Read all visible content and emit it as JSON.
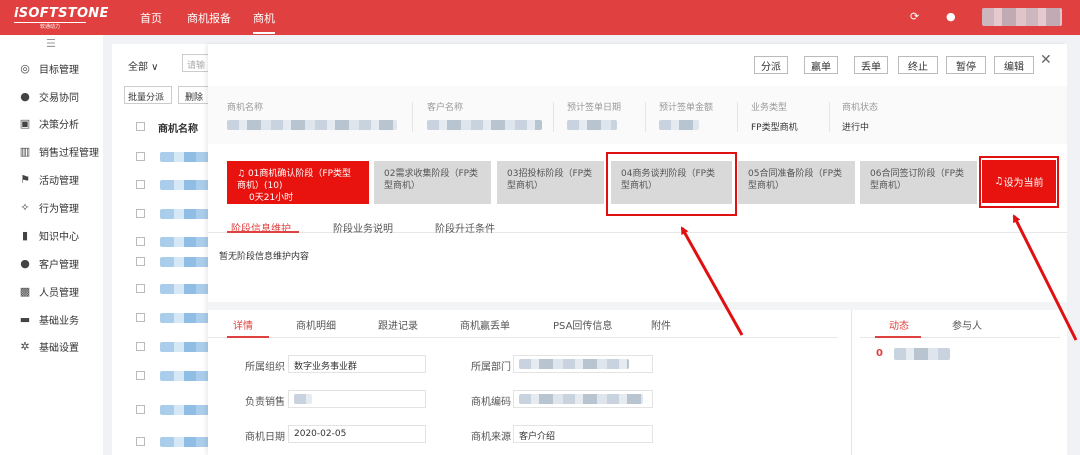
{
  "topbar": {
    "logo_main": "iSOFTSTONE",
    "logo_sub": "软通动力",
    "nav": [
      "首页",
      "商机报备",
      "商机"
    ],
    "refresh_icon": "refresh-icon",
    "user_icon": "user-icon"
  },
  "sidebar": {
    "items": [
      {
        "label": "目标管理",
        "icon": "target-icon"
      },
      {
        "label": "交易协同",
        "icon": "handshake-icon"
      },
      {
        "label": "决策分析",
        "icon": "chart-icon"
      },
      {
        "label": "销售过程管理",
        "icon": "bar-chart-icon"
      },
      {
        "label": "活动管理",
        "icon": "flag-icon"
      },
      {
        "label": "行为管理",
        "icon": "run-icon"
      },
      {
        "label": "知识中心",
        "icon": "book-icon"
      },
      {
        "label": "客户管理",
        "icon": "customer-icon"
      },
      {
        "label": "人员管理",
        "icon": "person-card-icon"
      },
      {
        "label": "基础业务",
        "icon": "briefcase-icon"
      },
      {
        "label": "基础设置",
        "icon": "gear-icon"
      }
    ]
  },
  "list": {
    "filter": "全部",
    "search_placeholder": "请输",
    "batch_assign": "批量分派",
    "delete": "删除",
    "col_name": "商机名称"
  },
  "panel": {
    "actions": [
      "分派",
      "赢单",
      "丢单",
      "终止",
      "暂停",
      "编辑"
    ],
    "info": [
      {
        "label": "商机名称",
        "value": ""
      },
      {
        "label": "客户名称",
        "value": ""
      },
      {
        "label": "预计签单日期",
        "value": ""
      },
      {
        "label": "预计签单金额",
        "value": ""
      },
      {
        "label": "业务类型",
        "value": "FP类型商机"
      },
      {
        "label": "商机状态",
        "value": "进行中"
      }
    ],
    "stages": [
      {
        "label": "01商机确认阶段（FP类型商机）(10)",
        "sub": "0天21小时"
      },
      {
        "label": "02需求收集阶段（FP类型商机）"
      },
      {
        "label": "03招投标阶段（FP类型商机）"
      },
      {
        "label": "04商务谈判阶段（FP类型商机）"
      },
      {
        "label": "05合同准备阶段（FP类型商机）"
      },
      {
        "label": "06合同签订阶段（FP类型商机）"
      }
    ],
    "set_current": "设为当前",
    "stage_tabs": [
      "阶段信息维护",
      "阶段业务说明",
      "阶段升迁条件"
    ],
    "stage_empty": "暂无阶段信息维护内容",
    "detail_tabs": [
      "详情",
      "商机明细",
      "跟进记录",
      "商机赢丢单",
      "PSA回传信息",
      "附件"
    ],
    "right_tabs": [
      "动态",
      "参与人"
    ],
    "activity_badge": "0",
    "fields": {
      "org_label": "所属组织",
      "org_value": "数字业务事业群",
      "dept_label": "所属部门",
      "dept_value": "",
      "sales_label": "负责销售",
      "sales_value": "",
      "code_label": "商机编码",
      "code_value": "",
      "date_label": "商机日期",
      "date_value": "2020-02-05",
      "source_label": "商机来源",
      "source_value": "客户介绍"
    }
  }
}
